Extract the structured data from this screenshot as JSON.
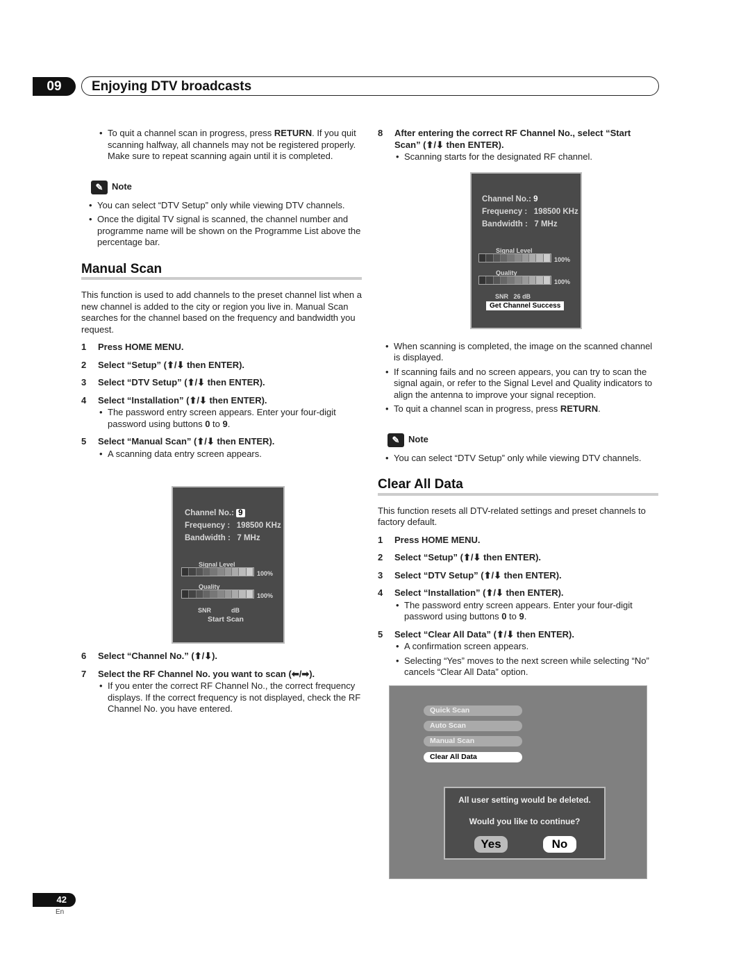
{
  "header": {
    "chapter": "09",
    "title": "Enjoying DTV broadcasts"
  },
  "left": [
    {
      "t": "bullet",
      "segs": [
        "To quit a channel scan in progress, press ",
        {
          "b": "RETURN"
        },
        ". If you quit scanning halfway, all channels may not be registered properly. Make sure to repeat scanning again until it is completed."
      ]
    },
    {
      "t": "note",
      "label": "Note"
    },
    {
      "t": "nbullet",
      "segs": [
        "You can select “DTV Setup” only while viewing DTV channels."
      ]
    },
    {
      "t": "nbullet",
      "segs": [
        "Once the digital TV signal is scanned, the channel number and programme name will be shown on the Programme List above the percentage bar."
      ]
    },
    {
      "t": "h2",
      "text": "Manual Scan"
    },
    {
      "t": "para",
      "segs": [
        "This function is used to add channels to the preset channel list when a new channel is added to the city or region you live in. Manual Scan searches for the channel based on the frequency and bandwidth you request."
      ]
    },
    {
      "t": "step",
      "n": "1",
      "text": "Press HOME MENU."
    },
    {
      "t": "step",
      "n": "2",
      "text": "Select “Setup” (⬆/⬇ then ENTER)."
    },
    {
      "t": "step",
      "n": "3",
      "text": "Select “DTV Setup” (⬆/⬇ then ENTER)."
    },
    {
      "t": "step",
      "n": "4",
      "text": "Select “Installation” (⬆/⬇ then ENTER)."
    },
    {
      "t": "bullet",
      "segs": [
        "The password entry screen appears. Enter your four-digit password using buttons ",
        {
          "b": "0"
        },
        " to ",
        {
          "b": "9"
        },
        "."
      ]
    },
    {
      "t": "step",
      "n": "5",
      "text": "Select “Manual Scan” (⬆/⬇ then ENTER)."
    },
    {
      "t": "bullet",
      "segs": [
        "A scanning data entry screen appears."
      ]
    },
    {
      "t": "space",
      "h": 262
    },
    {
      "t": "step",
      "n": "6",
      "text": "Select “Channel No.” (⬆/⬇)."
    },
    {
      "t": "step",
      "n": "7",
      "text": "Select the RF Channel No. you want to scan (⬅/➡)."
    },
    {
      "t": "bullet",
      "segs": [
        "If you enter the correct RF Channel No., the correct frequency displays. If the correct frequency is not displayed, check the RF Channel No. you have entered."
      ]
    }
  ],
  "right": [
    {
      "t": "step",
      "n": "8",
      "text": "After entering the correct RF Channel No., select “Start Scan” (⬆/⬇ then ENTER).",
      "first": true
    },
    {
      "t": "bullet",
      "segs": [
        "Scanning starts for the designated RF channel."
      ]
    },
    {
      "t": "space",
      "h": 252
    },
    {
      "t": "nbullet",
      "segs": [
        "When scanning is completed, the image on the scanned channel is displayed."
      ]
    },
    {
      "t": "nbullet",
      "segs": [
        "If scanning fails and no screen appears, you can try to scan the signal again, or refer to the Signal Level and Quality indicators to align the antenna to improve your signal reception."
      ]
    },
    {
      "t": "nbullet",
      "segs": [
        "To quit a channel scan in progress, press ",
        {
          "b": "RETURN"
        },
        "."
      ]
    },
    {
      "t": "note",
      "label": "Note"
    },
    {
      "t": "nbullet",
      "segs": [
        "You can select “DTV Setup” only while viewing DTV channels."
      ]
    },
    {
      "t": "h2",
      "text": "Clear All Data"
    },
    {
      "t": "para",
      "segs": [
        "This function resets all DTV-related settings and preset channels to factory default."
      ]
    },
    {
      "t": "step",
      "n": "1",
      "text": "Press HOME MENU."
    },
    {
      "t": "step",
      "n": "2",
      "text": "Select “Setup” (⬆/⬇ then ENTER)."
    },
    {
      "t": "step",
      "n": "3",
      "text": "Select “DTV Setup” (⬆/⬇ then ENTER)."
    },
    {
      "t": "step",
      "n": "4",
      "text": "Select “Installation” (⬆/⬇ then ENTER)."
    },
    {
      "t": "bullet",
      "segs": [
        "The password entry screen appears. Enter your four-digit password using buttons ",
        {
          "b": "0"
        },
        " to ",
        {
          "b": "9"
        },
        "."
      ]
    },
    {
      "t": "step",
      "n": "5",
      "text": "Select “Clear All Data” (⬆/⬇ then ENTER)."
    },
    {
      "t": "bullet",
      "segs": [
        "A confirmation screen appears."
      ]
    },
    {
      "t": "bullet",
      "segs": [
        "Selecting “Yes” moves to the next screen while selecting “No” cancels “Clear All Data” option."
      ]
    }
  ],
  "screen_manual": {
    "channel_label": "Channel No.:",
    "channel": "9",
    "freq_label": "Frequency :",
    "freq": "198500 KHz",
    "bw_label": "Bandwidth :",
    "bw": "7 MHz",
    "signal_label": "Signal Level",
    "signal_pct": "100%",
    "quality_label": "Quality",
    "quality_pct": "100%",
    "snr_label": "SNR",
    "snr_unit": "dB",
    "action": "Start Scan"
  },
  "screen_result": {
    "channel_label": "Channel No.:",
    "channel": "9",
    "freq_label": "Frequency :",
    "freq": "198500 KHz",
    "bw_label": "Bandwidth :",
    "bw": "7 MHz",
    "signal_label": "Signal Level",
    "signal_pct": "100%",
    "quality_label": "Quality",
    "quality_pct": "100%",
    "snr_label": "SNR",
    "snr_value": "26",
    "snr_unit": "dB",
    "status": "Get Channel Success"
  },
  "screen_clear": {
    "menu": [
      "Quick Scan",
      "Auto Scan",
      "Manual Scan",
      "Clear All Data"
    ],
    "selected": 3,
    "message1": "All user setting would be deleted.",
    "message2": "Would you like to continue?",
    "yes": "Yes",
    "no": "No"
  },
  "footer": {
    "page": "42",
    "lang": "En"
  }
}
